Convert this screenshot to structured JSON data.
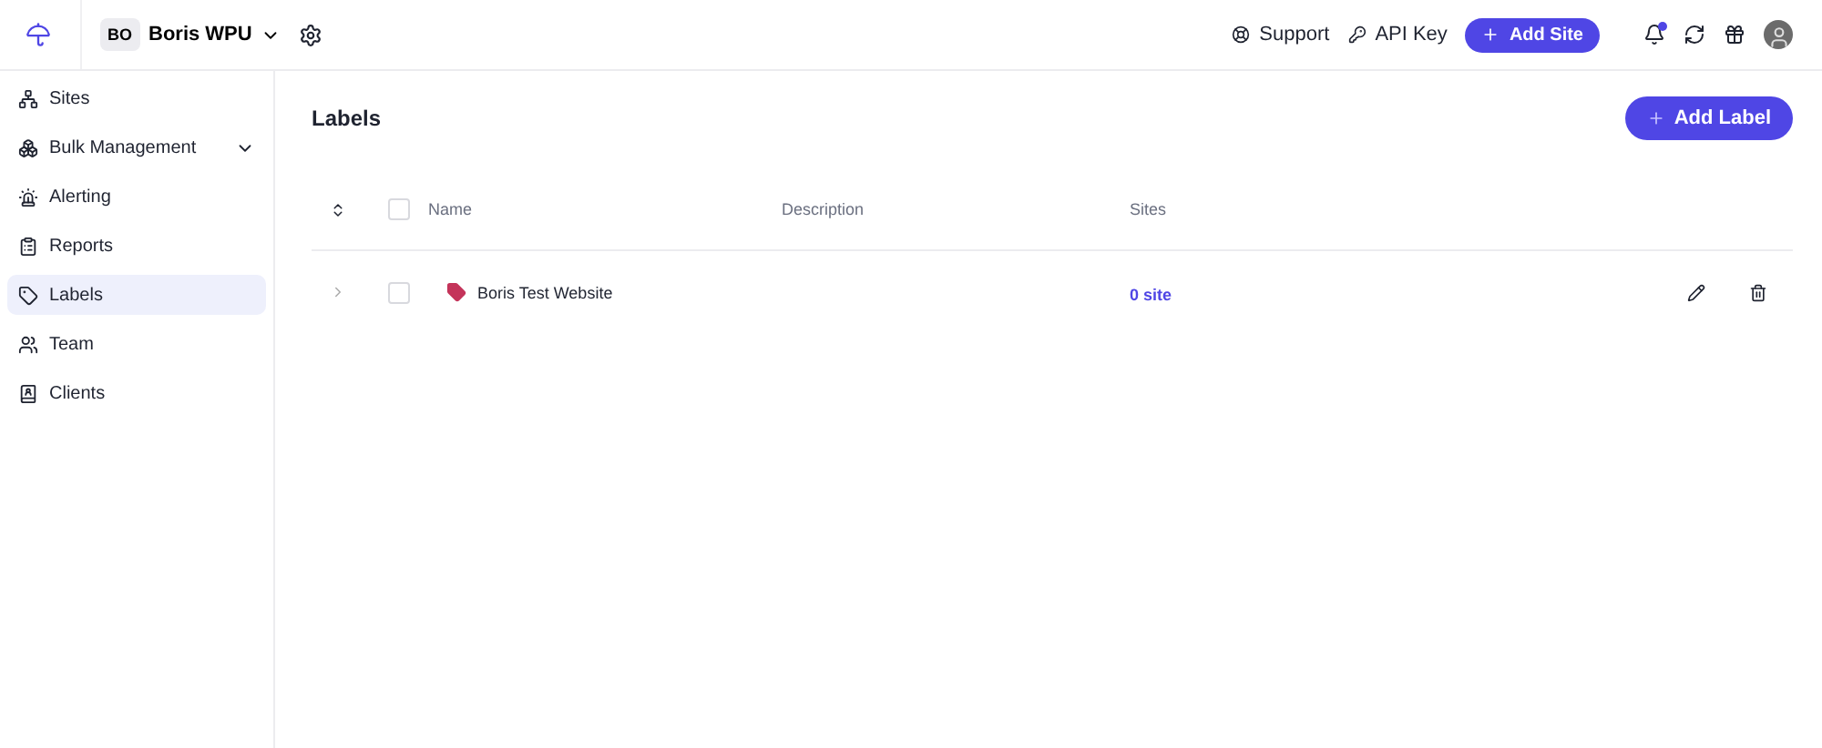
{
  "topbar": {
    "workspace": {
      "initials": "BO",
      "name": "Boris WPU"
    },
    "support": "Support",
    "api_key": "API Key",
    "add_site": "Add Site",
    "notifications_unread": true
  },
  "sidebar": {
    "items": [
      {
        "label": "Sites",
        "selected": false,
        "expandable": false
      },
      {
        "label": "Bulk Management",
        "selected": false,
        "expandable": true
      },
      {
        "label": "Alerting",
        "selected": false,
        "expandable": false
      },
      {
        "label": "Reports",
        "selected": false,
        "expandable": false
      },
      {
        "label": "Labels",
        "selected": true,
        "expandable": false
      },
      {
        "label": "Team",
        "selected": false,
        "expandable": false
      },
      {
        "label": "Clients",
        "selected": false,
        "expandable": false
      }
    ]
  },
  "page": {
    "title": "Labels",
    "add_button": "Add Label"
  },
  "table": {
    "columns": [
      "Name",
      "Description",
      "Sites"
    ],
    "all_checked": false,
    "rows": [
      {
        "name": "Boris Test Website",
        "color": "#c4345a",
        "sites": "0 site",
        "checked": false
      }
    ]
  }
}
